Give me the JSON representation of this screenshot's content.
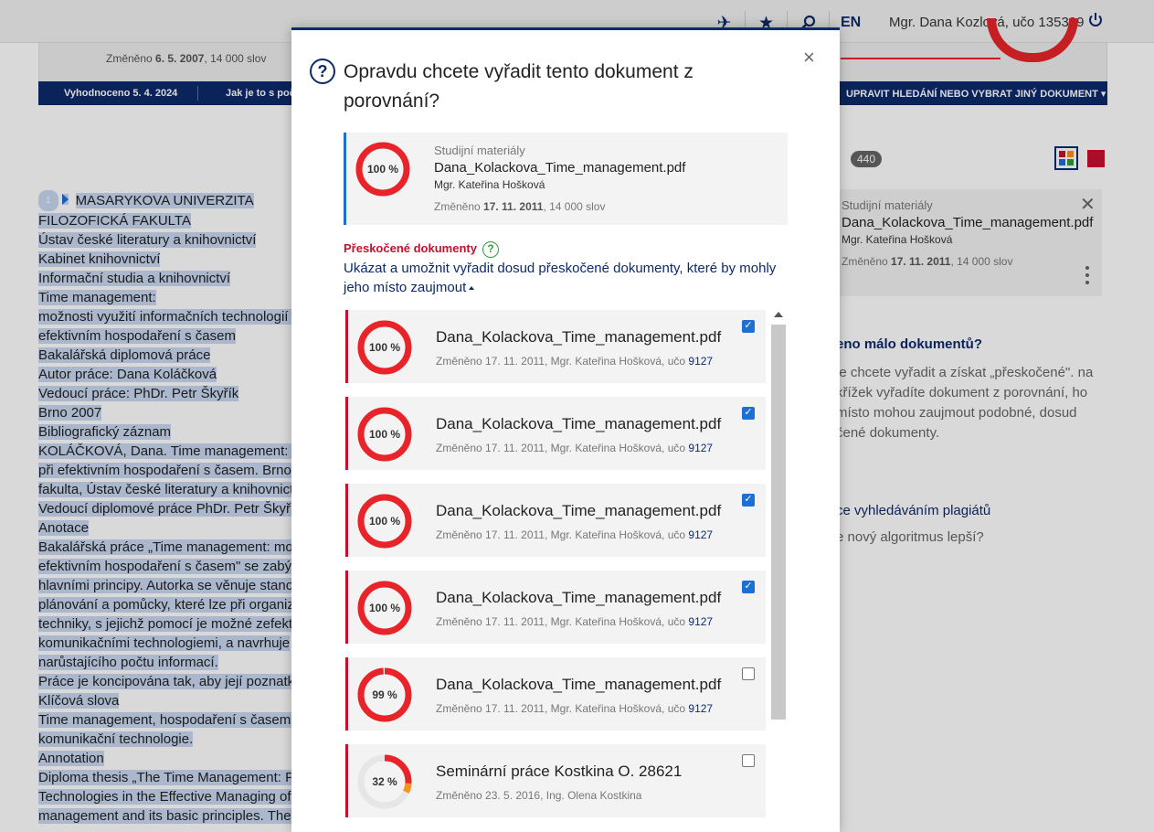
{
  "topbar": {
    "icons": [
      "plane-icon",
      "star-icon",
      "search-icon"
    ],
    "lang": "EN",
    "user": "Mgr. Dana Kozlová, učo 135399"
  },
  "background": {
    "changed_prefix": "Změněno ",
    "changed_date": "6. 5. 2007",
    "changed_suffix": ", 14 000 slov",
    "nav_evaluated": "Vyhodnoceno 5. 4. 2024",
    "nav_how": "Jak je to s poč",
    "nav_edit": "UPRAVIT HLEDÁNÍ NEBO VYBRAT JINÝ DOKUMENT",
    "page_badge": "1",
    "doc_lines": [
      "MASARYKOVA UNIVERZITA",
      "FILOZOFICKÁ FAKULTA",
      "Ústav české literatury a knihovnictví",
      "Kabinet knihovnictví",
      "Informační studia a knihovnictví",
      "Time management:",
      "možnosti využití informačních technologií p",
      "efektivním hospodaření s časem",
      "Bakalářská diplomová práce",
      "Autor práce: Dana Koláčková",
      "Vedoucí práce: PhDr. Petr Škyřík",
      "Brno 2007",
      "Bibliografický záznam",
      "KOLÁČKOVÁ, Dana. Time management: mo",
      "při efektivním hospodaření s časem. Brno",
      "fakulta, Ústav české literatury a knihovnict",
      "Vedoucí diplomové práce PhDr. Petr Škyřík",
      "Anotace",
      "Bakalářská práce „Time management: mož",
      "efektivním hospodaření s časem\" se zabýv",
      "hlavními principy. Autorka se věnuje stano",
      "plánování a pomůcky, které lze při organizo",
      "techniky, s jejichž pomocí je možné zefekti",
      "komunikačními technologiemi, a navrhuje",
      "narůstajícího počtu informací.",
      "Práce je koncipována tak, aby její poznatky",
      "Klíčová slova",
      "Time management, hospodaření s časem,",
      "komunikační technologie.",
      "Annotation",
      "Diploma thesis „The Time Management: Po",
      "Technologies in the Effective Managing of",
      "management and its basic principles. The a"
    ],
    "count_badge": "440",
    "side_card": {
      "category": "Studijní materiály",
      "filename": "Dana_Kolackova_Time_management.pdf",
      "author": "Mgr. Kateřina Hošková",
      "changed_prefix": "Změněno ",
      "changed_date": "17. 11. 2011",
      "changed_suffix": ", 14 000 slov"
    },
    "side_help_title": "eno málo dokumentů?",
    "side_help_text": "je chcete vyřadit a získat „přeskočené\". na křížek vyřadíte dokument z porovnání, ho místo mohou zaujmout podobné, dosud čené dokumenty.",
    "side_link": "ce vyhledáváním plagiátů",
    "side_link2": "e nový algoritmus lepší?"
  },
  "modal": {
    "title": "Opravdu chcete vyřadit tento dokument z porovnání?",
    "close_label": "×",
    "question_mark": "?",
    "doc": {
      "percent": 100,
      "percent_label": "100 %",
      "category": "Studijní materiály",
      "filename": "Dana_Kolackova_Time_management.pdf",
      "author": "Mgr. Kateřina Hošková",
      "changed_prefix": "Změněno ",
      "changed_date": "17. 11. 2011",
      "changed_suffix": ", 14 000 slov"
    },
    "skipped_title": "Přeskočené dokumenty",
    "skipped_help": "?",
    "skipped_link": "Ukázat a umožnit vyřadit dosud přeskočené dokumenty, které by mohly jeho místo zaujmout",
    "items": [
      {
        "percent": 100,
        "percent_label": "100 %",
        "filename": "Dana_Kolackova_Time_management.pdf",
        "meta": "Změněno 17. 11. 2011, Mgr. Kateřina Hošková, učo ",
        "id": "9127",
        "checked": true
      },
      {
        "percent": 100,
        "percent_label": "100 %",
        "filename": "Dana_Kolackova_Time_management.pdf",
        "meta": "Změněno 17. 11. 2011, Mgr. Kateřina Hošková, učo ",
        "id": "9127",
        "checked": true
      },
      {
        "percent": 100,
        "percent_label": "100 %",
        "filename": "Dana_Kolackova_Time_management.pdf",
        "meta": "Změněno 17. 11. 2011, Mgr. Kateřina Hošková, učo ",
        "id": "9127",
        "checked": true
      },
      {
        "percent": 100,
        "percent_label": "100 %",
        "filename": "Dana_Kolackova_Time_management.pdf",
        "meta": "Změněno 17. 11. 2011, Mgr. Kateřina Hošková, učo ",
        "id": "9127",
        "checked": true
      },
      {
        "percent": 99,
        "percent_label": "99 %",
        "filename": "Dana_Kolackova_Time_management.pdf",
        "meta": "Změněno 17. 11. 2011, Mgr. Kateřina Hošková, učo ",
        "id": "9127",
        "checked": false
      },
      {
        "percent": 32,
        "percent_label": "32 %",
        "filename": "Seminární práce Kostkina O. 28621",
        "meta": "Změněno 23. 5. 2016, Ing. Olena Kostkina",
        "id": "",
        "checked": false
      }
    ]
  },
  "colors": {
    "brand_navy": "#0d2a6b",
    "ring_red": "#e8242a",
    "accent_red": "#c8102e",
    "checkbox_blue": "#1b6fd6",
    "help_green": "#2e9d3a",
    "ring_orange": "#f7941d",
    "ring_yellow": "#ffd200"
  }
}
